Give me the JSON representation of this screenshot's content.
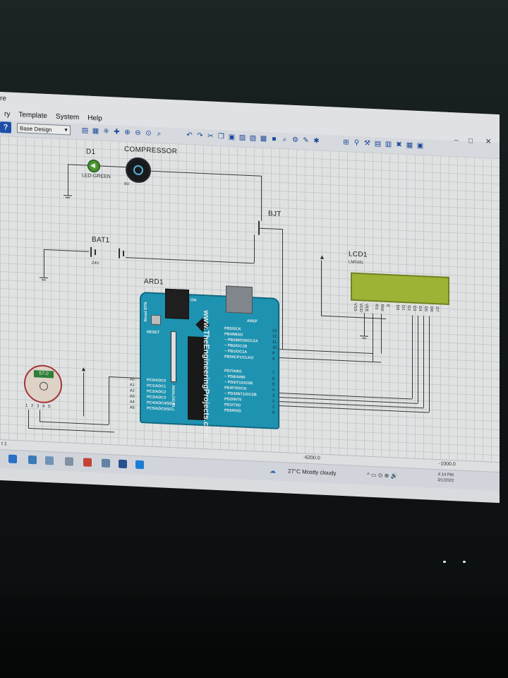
{
  "menu": {
    "partial_top": "re",
    "items": [
      "ry",
      "Template",
      "System",
      "Help"
    ]
  },
  "toolbar": {
    "layer_select_value": "Base Design",
    "help_label": "?"
  },
  "window_controls": [
    "–",
    "□",
    "✕"
  ],
  "schematic": {
    "d1": {
      "ref": "D1",
      "value": "LED-GREEN"
    },
    "compressor": {
      "ref": "COMPRESSOR",
      "value": "9V"
    },
    "bjt": {
      "ref": "BJT"
    },
    "battery": {
      "ref": "BAT1",
      "value": "24V"
    },
    "lcd": {
      "ref": "LCD1",
      "value": "LM016L",
      "pins": [
        "VSS",
        "VDD",
        "VEE",
        "RS",
        "RW",
        "E",
        "D0",
        "D1",
        "D2",
        "D3",
        "D4",
        "D5",
        "D6",
        "D7"
      ]
    },
    "arduino": {
      "ref": "ARD1",
      "site": "www.TheEngineeringProjects.com",
      "reset_btn": "Reset BTN",
      "on_label": "ON",
      "reset_pin": "RESET",
      "analog_label": "ANALOG IN",
      "aref": "AREF",
      "analog_pins": [
        "PC0/ADC0",
        "PC1/ADC1",
        "PC2/ADC2",
        "PC3/ADC3",
        "PC4/ADC4/SDA",
        "PC5/ADC5/SCL"
      ],
      "analog_nums": [
        "A0",
        "A1",
        "A2",
        "A3",
        "A4",
        "A5"
      ],
      "digital_pins_top": [
        "PB5/SCK",
        "PB4/MISO",
        "~ PB3/MOSI/OC2A",
        "~ PB2/OC1B",
        "~ PB1/OC1A",
        "PB0/ICP1/CLKO"
      ],
      "digital_nums_top": [
        "13",
        "12",
        "11",
        "10",
        "9",
        "8"
      ],
      "digital_pins_bottom": [
        "PD7/AIN1",
        "~ PD6/AIN0",
        "~ PD5/T1/OC0B",
        "PD4/T0/XCK",
        "~ PD3/INT1/OC2B",
        "PD2/INT0",
        "PD1/TXD",
        "PD0/RXD"
      ],
      "digital_nums_bottom": [
        "7",
        "6",
        "5",
        "4",
        "3",
        "2",
        "1",
        "0"
      ]
    },
    "sensor": {
      "reading": "57.0",
      "pins": [
        "1",
        "2",
        "3",
        "4",
        "5"
      ]
    }
  },
  "statusbar": {
    "left": "t 1",
    "coord_x": "-6200.0",
    "coord_y": "-1000.0"
  },
  "taskbar": {
    "weather": "27°C  Mostly cloudy",
    "time": "4:14 PM",
    "date": "3/1/2022"
  },
  "colors": {
    "arduino_board": "#1fa0c0",
    "lcd_screen": "#a8c43a",
    "toolbar_bg": "#e9ecf0",
    "grid_line": "#d7dcdf"
  }
}
